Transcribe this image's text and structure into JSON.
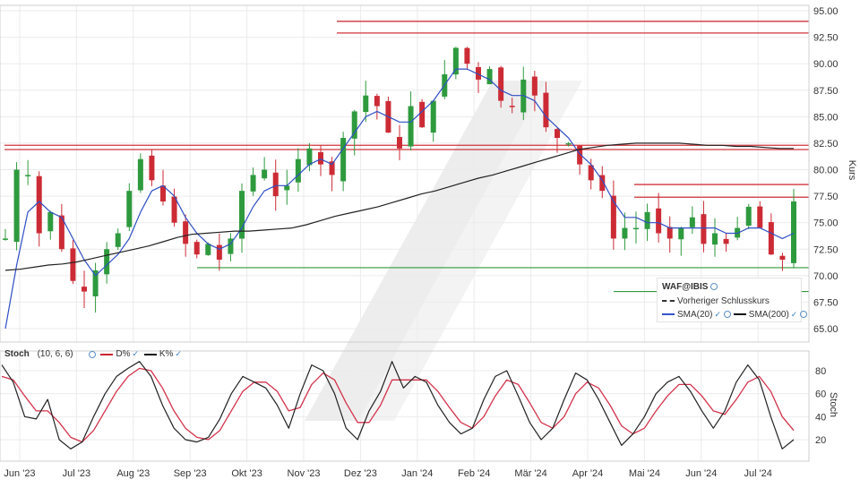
{
  "chart_data": {
    "type": "candlestick",
    "instrument": "WAF@IBIS",
    "price_axis": {
      "label": "Kurs",
      "ylim": [
        63.0,
        95.5
      ],
      "ticks": [
        65.0,
        67.5,
        70.0,
        72.5,
        75.0,
        77.5,
        80.0,
        82.5,
        85.0,
        87.5,
        90.0,
        92.5,
        95.0
      ],
      "tick_labels": [
        "65.00",
        "67.50",
        "70.00",
        "72.50",
        "75.00",
        "77.50",
        "80.00",
        "82.50",
        "85.00",
        "87.50",
        "90.00",
        "92.50",
        "95.00"
      ]
    },
    "x_axis": {
      "labels": [
        "Jun '23",
        "Jul '23",
        "Aug '23",
        "Sep '23",
        "Okt '23",
        "Nov '23",
        "Dez '23",
        "Jan '24",
        "Feb '24",
        "Mär '24",
        "Apr '24",
        "Mai '24",
        "Jun '24",
        "Jul '24"
      ]
    },
    "price_series": [
      73.5,
      80.0,
      79.5,
      74.0,
      76.0,
      72.5,
      69.5,
      68.5,
      70.5,
      72.5,
      74.0,
      78.0,
      81.0,
      79.0,
      77.0,
      75.0,
      73.0,
      72.0,
      73.0,
      71.5,
      73.5,
      78.0,
      79.5,
      80.0,
      77.5,
      78.5,
      81.0,
      82.0,
      80.5,
      79.5,
      83.0,
      85.5,
      87.0,
      86.0,
      83.5,
      82.0,
      86.0,
      84.0,
      86.5,
      89.0,
      91.5,
      90.0,
      88.5,
      89.5,
      86.5,
      86.0,
      88.5,
      87.0,
      84.0,
      83.0,
      82.5,
      80.5,
      79.0,
      78.0,
      73.5,
      74.5,
      74.5,
      76.0,
      74.0,
      73.5,
      74.5,
      75.5,
      73.0,
      74.0,
      73.0,
      74.5,
      76.5,
      74.5,
      72.0,
      71.5,
      77.0
    ],
    "sma20": [
      65.0,
      71.0,
      76.0,
      77.0,
      76.0,
      75.5,
      73.5,
      71.5,
      70.0,
      71.0,
      72.0,
      73.5,
      76.0,
      78.0,
      78.5,
      77.5,
      75.5,
      74.0,
      73.0,
      72.5,
      73.0,
      74.5,
      76.5,
      78.0,
      78.5,
      78.5,
      79.5,
      80.5,
      81.0,
      80.5,
      82.0,
      83.5,
      85.0,
      85.5,
      85.0,
      84.5,
      84.5,
      85.5,
      86.5,
      88.0,
      89.5,
      89.5,
      89.0,
      88.5,
      87.5,
      87.0,
      87.0,
      86.5,
      85.0,
      84.0,
      83.0,
      81.5,
      80.5,
      79.0,
      77.0,
      75.5,
      75.5,
      75.0,
      75.0,
      74.5,
      74.5,
      74.5,
      74.5,
      74.5,
      74.0,
      74.0,
      74.5,
      74.5,
      74.0,
      73.5,
      74.0
    ],
    "sma200": [
      70.5,
      70.6,
      70.8,
      71.0,
      71.1,
      71.3,
      71.6,
      71.9,
      72.2,
      72.5,
      72.8,
      73.2,
      73.6,
      73.9,
      74.0,
      74.1,
      74.2,
      74.2,
      74.3,
      74.4,
      74.5,
      74.8,
      75.2,
      75.6,
      75.9,
      76.2,
      76.5,
      76.9,
      77.3,
      77.7,
      78.0,
      78.4,
      78.8,
      79.2,
      79.5,
      79.9,
      80.3,
      80.7,
      81.1,
      81.5,
      81.9,
      82.1,
      82.3,
      82.4,
      82.5,
      82.5,
      82.5,
      82.5,
      82.4,
      82.3,
      82.3,
      82.2,
      82.2,
      82.1,
      82.0,
      82.0
    ],
    "horizontal_lines_red": [
      94.0,
      92.9,
      82.3,
      81.9,
      78.6,
      77.4
    ],
    "horizontal_lines_green": [
      70.75,
      68.5
    ],
    "legend": {
      "title": "WAF@IBIS",
      "prev_close": "Vorheriger Schlusskurs",
      "sma20": "SMA(20)",
      "sma200": "SMA(200)"
    },
    "stoch": {
      "title": "Stoch",
      "params": "(10, 6, 6)",
      "d_label": "D%",
      "k_label": "K%",
      "axis_label": "Stoch",
      "ylim": [
        8,
        95
      ],
      "ticks": [
        20,
        40,
        60,
        80
      ],
      "k_series": [
        85,
        70,
        40,
        38,
        55,
        20,
        12,
        18,
        40,
        60,
        75,
        82,
        88,
        75,
        50,
        30,
        20,
        18,
        22,
        38,
        60,
        75,
        70,
        65,
        50,
        30,
        60,
        85,
        80,
        60,
        30,
        20,
        45,
        62,
        88,
        65,
        75,
        70,
        50,
        35,
        25,
        30,
        55,
        75,
        80,
        58,
        35,
        20,
        30,
        55,
        78,
        72,
        55,
        35,
        15,
        25,
        40,
        60,
        70,
        75,
        62,
        45,
        30,
        45,
        70,
        85,
        72,
        40,
        12,
        20
      ],
      "d_series": [
        75,
        72,
        58,
        45,
        45,
        35,
        22,
        18,
        28,
        45,
        62,
        75,
        82,
        80,
        65,
        45,
        30,
        22,
        20,
        28,
        45,
        62,
        70,
        70,
        62,
        45,
        48,
        68,
        78,
        72,
        52,
        35,
        35,
        50,
        72,
        72,
        72,
        72,
        62,
        48,
        35,
        30,
        40,
        58,
        72,
        68,
        52,
        35,
        30,
        40,
        60,
        70,
        65,
        50,
        32,
        25,
        30,
        45,
        58,
        68,
        68,
        58,
        45,
        42,
        55,
        70,
        75,
        62,
        40,
        28
      ]
    }
  }
}
